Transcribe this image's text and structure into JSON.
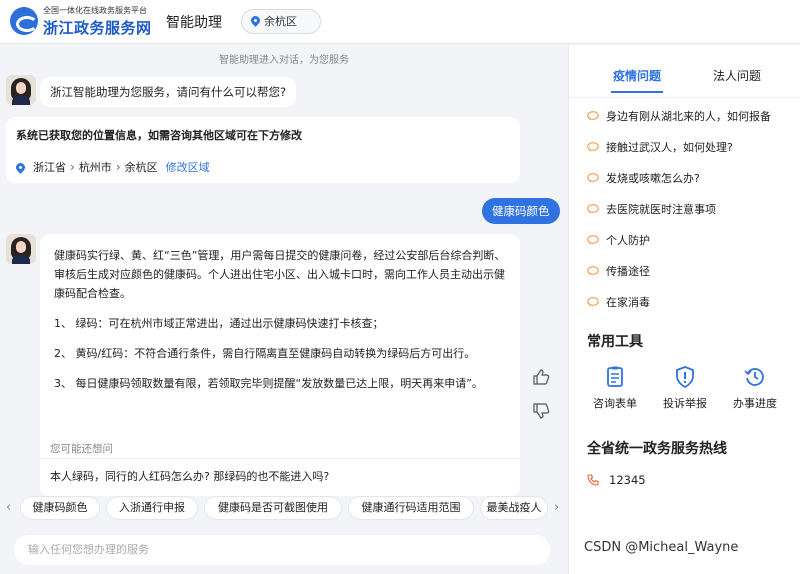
{
  "header": {
    "logo_sub": "全国一体化在线政务服务平台",
    "logo_main": "浙江政务服务网",
    "assistant_title": "智能助理",
    "region": "余杭区"
  },
  "chat": {
    "notice": "智能助理进入对话，为您服务",
    "greeting": "浙江智能助理为您服务，请问有什么可以帮您?",
    "location_card": {
      "title": "系统已获取您的位置信息，如需咨询其他区域可在下方修改",
      "province": "浙江省",
      "city": "杭州市",
      "district": "余杭区",
      "modify_label": "修改区域"
    },
    "user_message": "健康码颜色",
    "answer": {
      "p1": "健康码实行绿、黄、红“三色”管理，用户需每日提交的健康问卷，经过公安部后台综合判断、审核后生成对应颜色的健康码。个人进出住宅小区、出入城卡口时，需向工作人员主动出示健康码配合检查。",
      "p2": "1、  绿码：可在杭州市域正常进出，通过出示健康码快速打卡核查；",
      "p3": "2、  黄码/红码：不符合通行条件，需自行隔离直至健康码自动转换为绿码后方可出行。",
      "p4": "3、  每日健康码领取数量有限，若领取完毕则提醒“发放数量已达上限，明天再来申请”。"
    },
    "suggest": {
      "heading": "您可能还想问",
      "question": "本人绿码，同行的人红码怎么办? 那绿码的也不能进入吗?"
    },
    "chips": [
      "健康码颜色",
      "入浙通行申报",
      "健康码是否可截图使用",
      "健康通行码适用范围",
      "最美战疫人"
    ],
    "chip_prev": "‹",
    "chip_next": "›",
    "input_placeholder": "输入任何您想办理的服务"
  },
  "panel": {
    "tabs": [
      "疫情问题",
      "法人问题"
    ],
    "faq": [
      "身边有刚从湖北来的人，如何报备",
      "接触过武汉人，如何处理?",
      "发烧或咳嗽怎么办?",
      "去医院就医时注意事项",
      "个人防护",
      "传播途径",
      "在家消毒"
    ],
    "tools_title": "常用工具",
    "tools": [
      {
        "label": "咨询表单",
        "icon": "form-icon"
      },
      {
        "label": "投诉举报",
        "icon": "shield-alert-icon"
      },
      {
        "label": "办事进度",
        "icon": "history-clock-icon"
      }
    ],
    "hotline_title": "全省统一政务服务热线",
    "hotline_number": "12345"
  },
  "watermark": "CSDN @Micheal_Wayne",
  "colors": {
    "accent": "#2f72e0",
    "faq_icon": "#f0a050"
  }
}
